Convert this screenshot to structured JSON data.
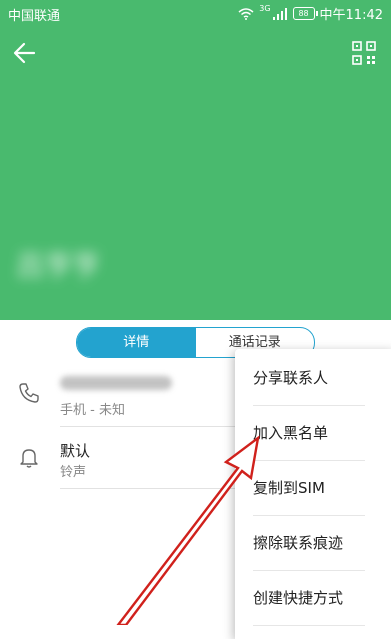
{
  "status_bar": {
    "carrier": "中国联通",
    "network": "3G",
    "battery": "88",
    "time": "中午11:42"
  },
  "header": {
    "contact_name": "吕亨亨",
    "back_icon": "back-arrow-icon",
    "qr_icon": "qr-code-icon",
    "background_color": "#49ba6e"
  },
  "tabs": [
    {
      "label": "详情",
      "active": true
    },
    {
      "label": "通话记录",
      "active": false
    }
  ],
  "details": {
    "phone_label": "手机 - 未知",
    "ringtone_value": "默认",
    "ringtone_label": "铃声"
  },
  "menu": {
    "items": [
      {
        "label": "分享联系人"
      },
      {
        "label": "加入黑名单"
      },
      {
        "label": "复制到SIM"
      },
      {
        "label": "擦除联系痕迹"
      },
      {
        "label": "创建快捷方式"
      }
    ]
  },
  "accent_color": "#23a3cf",
  "annotation_color": "#d0211c"
}
